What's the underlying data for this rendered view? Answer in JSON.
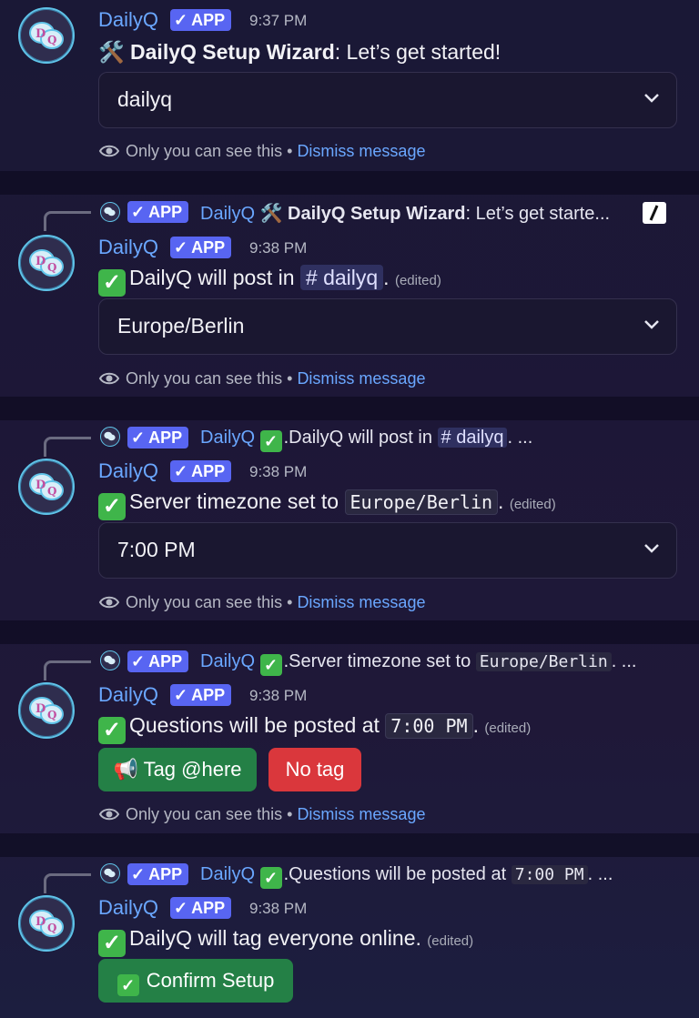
{
  "app": {
    "name": "DailyQ",
    "badge": "APP",
    "badge_check": "✓"
  },
  "ephemeral": {
    "text": "Only you can see this",
    "dot": "•",
    "dismiss": "Dismiss message"
  },
  "messages": [
    {
      "time": "9:37 PM",
      "content_emoji": "🛠️",
      "content_bold": "DailyQ Setup Wizard",
      "content_rest": ": Let’s get started!",
      "select_value": "dailyq"
    },
    {
      "reply_prefix": "DailyQ",
      "reply_emoji": "🛠️",
      "reply_bold": "DailyQ Setup Wizard",
      "reply_rest": ": Let’s get starte...",
      "time": "9:38 PM",
      "content_text": "DailyQ will post in",
      "content_channel": "# dailyq",
      "content_end": ".",
      "edited": "(edited)",
      "select_value": "Europe/Berlin"
    },
    {
      "reply_prefix": "DailyQ",
      "reply_text": ".DailyQ will post in",
      "reply_channel": "# dailyq",
      "reply_end": ". ...",
      "time": "9:38 PM",
      "content_text": "Server timezone set to",
      "content_code": "Europe/Berlin",
      "content_end": ".",
      "edited": "(edited)",
      "select_value": "7:00 PM"
    },
    {
      "reply_prefix": "DailyQ",
      "reply_text": ".Server timezone set to",
      "reply_code": "Europe/Berlin",
      "reply_end": ". ...",
      "time": "9:38 PM",
      "content_text": "Questions will be posted at",
      "content_code": "7:00 PM",
      "content_end": ".",
      "edited": "(edited)",
      "button_primary": "📢 Tag @here",
      "button_secondary": "No tag"
    },
    {
      "reply_prefix": "DailyQ",
      "reply_text": ".Questions will be posted at",
      "reply_code": "7:00 PM",
      "reply_end": ". ...",
      "time": "9:38 PM",
      "content_text": "DailyQ will tag everyone online.",
      "edited": "(edited)",
      "button_confirm": "Confirm Setup"
    }
  ]
}
